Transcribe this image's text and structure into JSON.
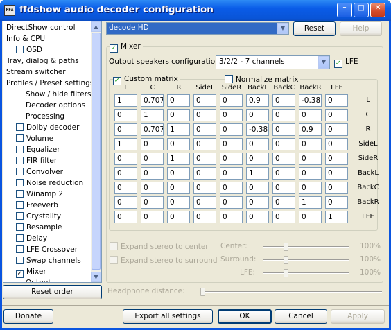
{
  "window": {
    "title": "ffdshow audio decoder configuration",
    "icon_text": "FFA",
    "controls": {
      "minimize": "–",
      "maximize": "□",
      "close": "✕"
    }
  },
  "nav": {
    "items": [
      {
        "label": "DirectShow control",
        "indent": 0,
        "checkbox": false
      },
      {
        "label": "Info & CPU",
        "indent": 0,
        "checkbox": false
      },
      {
        "label": "OSD",
        "indent": 1,
        "checkbox": true,
        "checked": false
      },
      {
        "label": "Tray, dialog & paths",
        "indent": 0,
        "checkbox": false
      },
      {
        "label": "Stream switcher",
        "indent": 0,
        "checkbox": false
      },
      {
        "label": "Profiles / Preset settings",
        "indent": 0,
        "checkbox": false
      },
      {
        "label": "Show / hide filters",
        "indent": 2,
        "checkbox": false
      },
      {
        "label": "Decoder options",
        "indent": 2,
        "checkbox": false
      },
      {
        "label": "Processing",
        "indent": 2,
        "checkbox": false
      },
      {
        "label": "Dolby decoder",
        "indent": 1,
        "checkbox": true,
        "checked": false
      },
      {
        "label": "Volume",
        "indent": 1,
        "checkbox": true,
        "checked": false
      },
      {
        "label": "Equalizer",
        "indent": 1,
        "checkbox": true,
        "checked": false
      },
      {
        "label": "FIR filter",
        "indent": 1,
        "checkbox": true,
        "checked": false
      },
      {
        "label": "Convolver",
        "indent": 1,
        "checkbox": true,
        "checked": false
      },
      {
        "label": "Noise reduction",
        "indent": 1,
        "checkbox": true,
        "checked": false
      },
      {
        "label": "Winamp 2",
        "indent": 1,
        "checkbox": true,
        "checked": false
      },
      {
        "label": "Freeverb",
        "indent": 1,
        "checkbox": true,
        "checked": false
      },
      {
        "label": "Crystality",
        "indent": 1,
        "checkbox": true,
        "checked": false
      },
      {
        "label": "Resample",
        "indent": 1,
        "checkbox": true,
        "checked": false
      },
      {
        "label": "Delay",
        "indent": 1,
        "checkbox": true,
        "checked": false
      },
      {
        "label": "LFE Crossover",
        "indent": 1,
        "checkbox": true,
        "checked": false
      },
      {
        "label": "Swap channels",
        "indent": 1,
        "checkbox": true,
        "checked": false
      },
      {
        "label": "Mixer",
        "indent": 1,
        "checkbox": true,
        "checked": true
      },
      {
        "label": "Output",
        "indent": 2,
        "checkbox": false
      }
    ],
    "reset_order": "Reset order"
  },
  "top": {
    "preset": "decode HD",
    "reset": "Reset",
    "help": "Help"
  },
  "mixer": {
    "enabled_label": "Mixer",
    "speakers_label": "Output speakers configuration:",
    "speakers_value": "3/2/2 - 7 channels",
    "lfe_label": "LFE",
    "custom_matrix_label": "Custom matrix",
    "normalize_label": "Normalize matrix",
    "columns": [
      "L",
      "C",
      "R",
      "SideL",
      "SideR",
      "BackL",
      "BackC",
      "BackR",
      "LFE"
    ],
    "rows": [
      {
        "name": "L",
        "values": [
          "1",
          "0.707",
          "0",
          "0",
          "0",
          "0.9",
          "0",
          "-0.38",
          "0"
        ]
      },
      {
        "name": "C",
        "values": [
          "0",
          "1",
          "0",
          "0",
          "0",
          "0",
          "0",
          "0",
          "0"
        ]
      },
      {
        "name": "R",
        "values": [
          "0",
          "0.707",
          "1",
          "0",
          "0",
          "-0.38",
          "0",
          "0.9",
          "0"
        ]
      },
      {
        "name": "SideL",
        "values": [
          "1",
          "0",
          "0",
          "0",
          "0",
          "0",
          "0",
          "0",
          "0"
        ]
      },
      {
        "name": "SideR",
        "values": [
          "0",
          "0",
          "1",
          "0",
          "0",
          "0",
          "0",
          "0",
          "0"
        ]
      },
      {
        "name": "BackL",
        "values": [
          "0",
          "0",
          "0",
          "0",
          "0",
          "1",
          "0",
          "0",
          "0"
        ]
      },
      {
        "name": "BackC",
        "values": [
          "0",
          "0",
          "0",
          "0",
          "0",
          "0",
          "0",
          "0",
          "0"
        ]
      },
      {
        "name": "BackR",
        "values": [
          "0",
          "0",
          "0",
          "0",
          "0",
          "0",
          "0",
          "1",
          "0"
        ]
      },
      {
        "name": "LFE",
        "values": [
          "0",
          "0",
          "0",
          "0",
          "0",
          "0",
          "0",
          "0",
          "1"
        ]
      }
    ],
    "expand_center_label": "Expand stereo to center",
    "expand_surround_label": "Expand stereo to surround",
    "center_label": "Center:",
    "surround_label": "Surround:",
    "lfe_level_label": "LFE:",
    "center_pct": "100%",
    "surround_pct": "100%",
    "lfe_pct": "100%",
    "center_level": 0.25,
    "surround_level": 0.25,
    "lfe_level": 0.25,
    "headphone_label": "Headphone distance:",
    "headphone_level": 0.0
  },
  "bottom": {
    "donate": "Donate",
    "export": "Export all settings",
    "ok": "OK",
    "cancel": "Cancel",
    "apply": "Apply"
  }
}
